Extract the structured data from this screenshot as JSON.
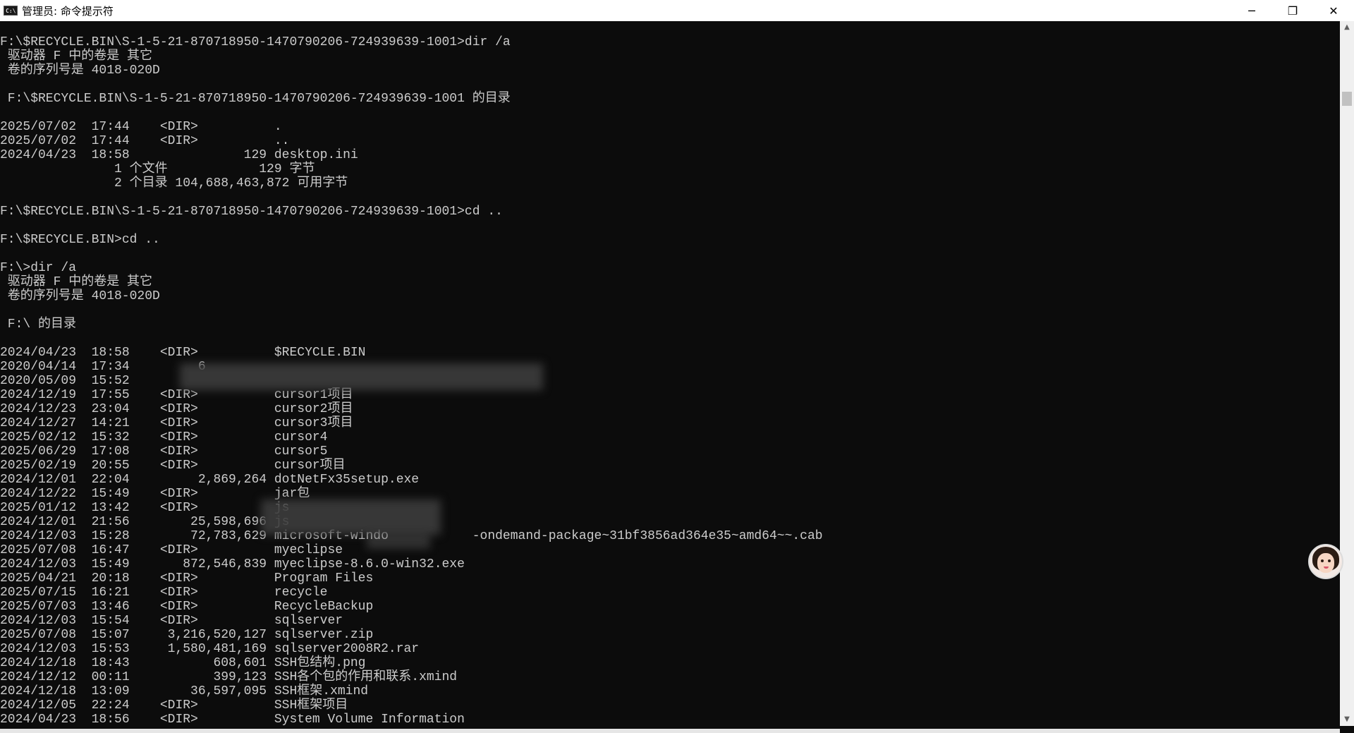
{
  "window": {
    "title": "管理员: 命令提示符",
    "icon_label": "C:\\",
    "minimize_glyph": "─",
    "maximize_glyph": "❐",
    "close_glyph": "✕"
  },
  "console": {
    "lines": [
      "F:\\$RECYCLE.BIN\\S-1-5-21-870718950-1470790206-724939639-1001>dir /a",
      " 驱动器 F 中的卷是 其它",
      " 卷的序列号是 4018-020D",
      "",
      " F:\\$RECYCLE.BIN\\S-1-5-21-870718950-1470790206-724939639-1001 的目录",
      "",
      "2025/07/02  17:44    <DIR>          .",
      "2025/07/02  17:44    <DIR>          ..",
      "2024/04/23  18:58               129 desktop.ini",
      "               1 个文件            129 字节",
      "               2 个目录 104,688,463,872 可用字节",
      "",
      "F:\\$RECYCLE.BIN\\S-1-5-21-870718950-1470790206-724939639-1001>cd ..",
      "",
      "F:\\$RECYCLE.BIN>cd ..",
      "",
      "F:\\>dir /a",
      " 驱动器 F 中的卷是 其它",
      " 卷的序列号是 4018-020D",
      "",
      " F:\\ 的目录",
      "",
      "2024/04/23  18:58    <DIR>          $RECYCLE.BIN",
      "2020/04/14  17:34         6",
      "2020/05/09  15:52",
      "2024/12/19  17:55    <DIR>          cursor1项目",
      "2024/12/23  23:04    <DIR>          cursor2项目",
      "2024/12/27  14:21    <DIR>          cursor3项目",
      "2025/02/12  15:32    <DIR>          cursor4",
      "2025/06/29  17:08    <DIR>          cursor5",
      "2025/02/19  20:55    <DIR>          cursor项目",
      "2024/12/01  22:04         2,869,264 dotNetFx35setup.exe",
      "2024/12/22  15:49    <DIR>          jar包",
      "2025/01/12  13:42    <DIR>          js",
      "2024/12/01  21:56        25,598,696 js",
      "2024/12/03  15:28        72,783,629 microsoft-windo           -ondemand-package~31bf3856ad364e35~amd64~~.cab",
      "2025/07/08  16:47    <DIR>          myeclipse",
      "2024/12/03  15:49       872,546,839 myeclipse-8.6.0-win32.exe",
      "2025/04/21  20:18    <DIR>          Program Files",
      "2025/07/15  16:21    <DIR>          recycle",
      "2025/07/03  13:46    <DIR>          RecycleBackup",
      "2024/12/03  15:54    <DIR>          sqlserver",
      "2025/07/08  15:07     3,216,520,127 sqlserver.zip",
      "2024/12/03  15:53     1,580,481,169 sqlserver2008R2.rar",
      "2024/12/18  18:43           608,601 SSH包结构.png",
      "2024/12/12  00:11           399,123 SSH各个包的作用和联系.xmind",
      "2024/12/18  13:09        36,597,095 SSH框架.xmind",
      "2024/12/05  22:24    <DIR>          SSH框架项目",
      "2024/04/23  18:56    <DIR>          System Volume Information"
    ]
  },
  "scrollbar": {
    "up_glyph": "▲",
    "down_glyph": "▼"
  },
  "colors": {
    "console_bg": "#0c0c0c",
    "console_fg": "#cccccc",
    "titlebar_bg": "#ffffff"
  }
}
